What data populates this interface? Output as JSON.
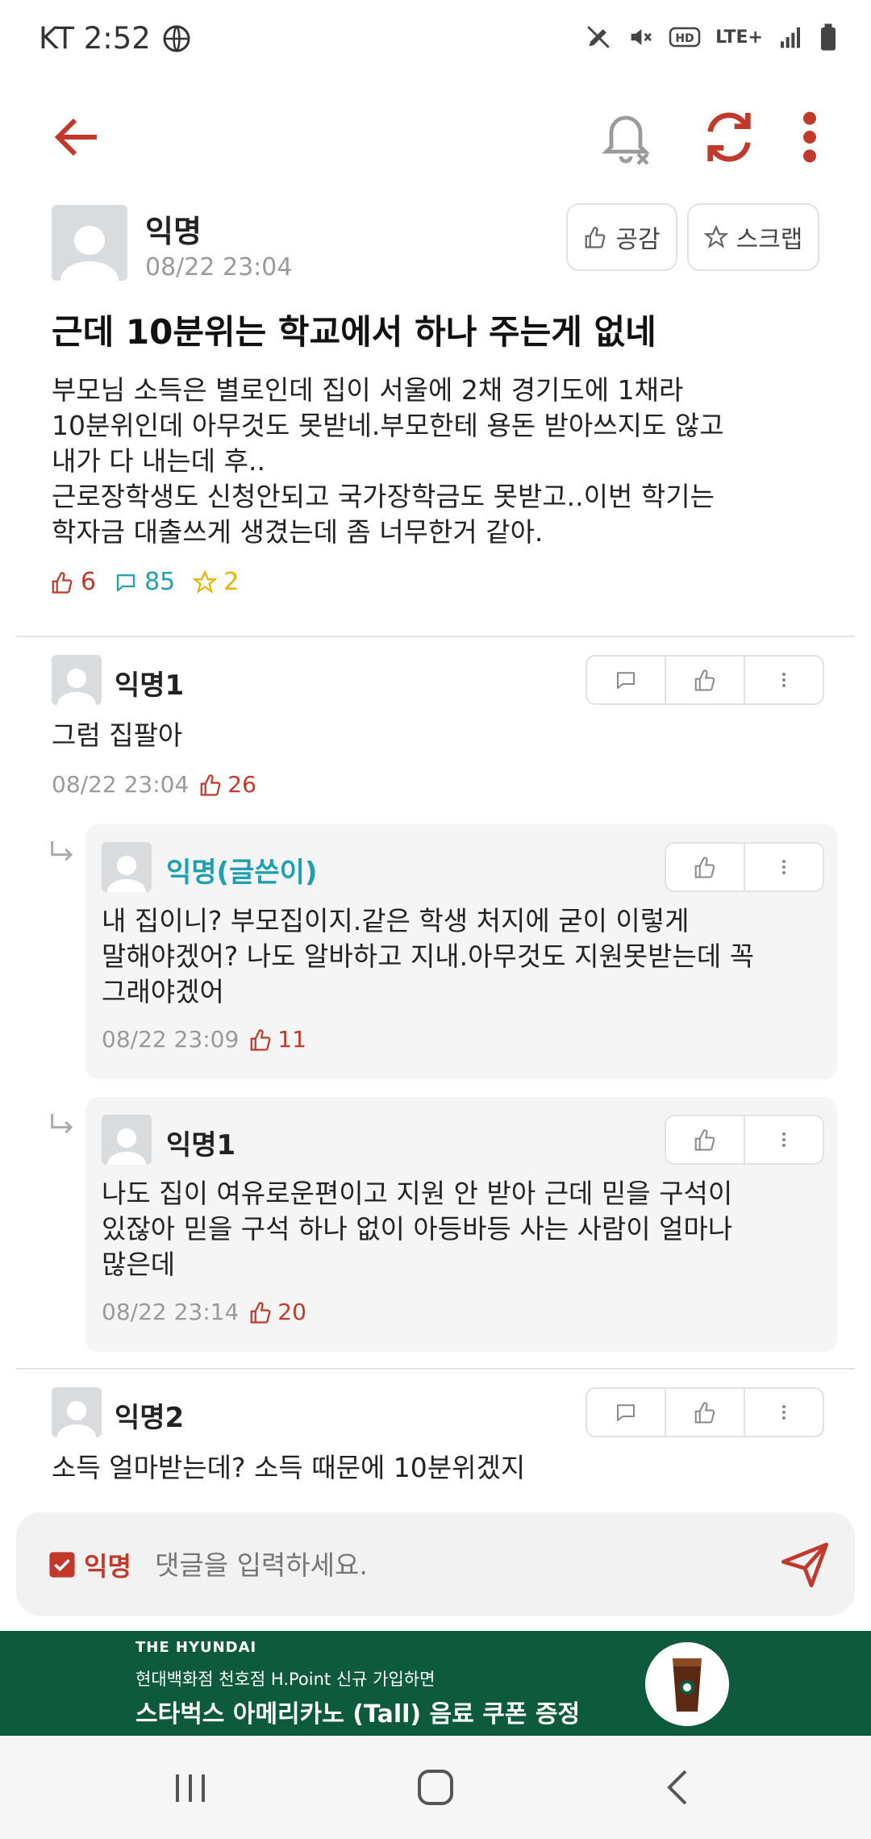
{
  "status": {
    "carrier_time": "KT 2:52",
    "network": "LTE+"
  },
  "colors": {
    "accent": "#c0392b",
    "teal": "#1f9fb0",
    "yellow": "#e6b400",
    "ad_bg": "#0d5b3c"
  },
  "toolbar": {
    "back_icon": "arrow-left-icon",
    "bell_icon": "bell-off-icon",
    "refresh_icon": "refresh-icon",
    "more_icon": "more-vertical-icon"
  },
  "post": {
    "author": "익명",
    "datetime": "08/22 23:04",
    "empathy_label": "공감",
    "scrap_label": "스크랩",
    "title": "근데 10분위는 학교에서 하나 주는게 없네",
    "body": "부모님 소득은 별로인데 집이 서울에 2채 경기도에 1채라\n10분위인데 아무것도 못받네.부모한테 용돈 받아쓰지도 않고\n내가 다 내는데 후..\n근로장학생도 신청안되고 국가장학금도 못받고..이번 학기는\n학자금 대출쓰게 생겼는데 좀 너무한거 같아.",
    "likes": "6",
    "comments": "85",
    "scraps": "2"
  },
  "comments": [
    {
      "author": "익명1",
      "text": "그럼 집팔아",
      "datetime": "08/22 23:04",
      "likes": "26"
    },
    {
      "author": "익명(글쓴이)",
      "text": "내 집이니? 부모집이지.같은 학생 처지에 굳이 이렇게\n말해야겠어? 나도 알바하고 지내.아무것도 지원못받는데 꼭\n그래야겠어",
      "datetime": "08/22 23:09",
      "likes": "11"
    },
    {
      "author": "익명1",
      "text": "나도 집이 여유로운편이고 지원 안 받아 근데 믿을 구석이\n있잖아 믿을 구석 하나 없이 아등바등 사는 사람이 얼마나\n많은데",
      "datetime": "08/22 23:14",
      "likes": "20"
    },
    {
      "author": "익명2",
      "text": "소득 얼마받는데? 소득 때문에 10분위겠지"
    }
  ],
  "input": {
    "anon_label": "익명",
    "placeholder": "댓글을 입력하세요."
  },
  "ad": {
    "brand": "THE HYUNDAI",
    "line1": "현대백화점 천호점 H.Point 신규 가입하면",
    "line2": "스타벅스 아메리카노 (Tall) 음료 쿠폰 증정"
  }
}
